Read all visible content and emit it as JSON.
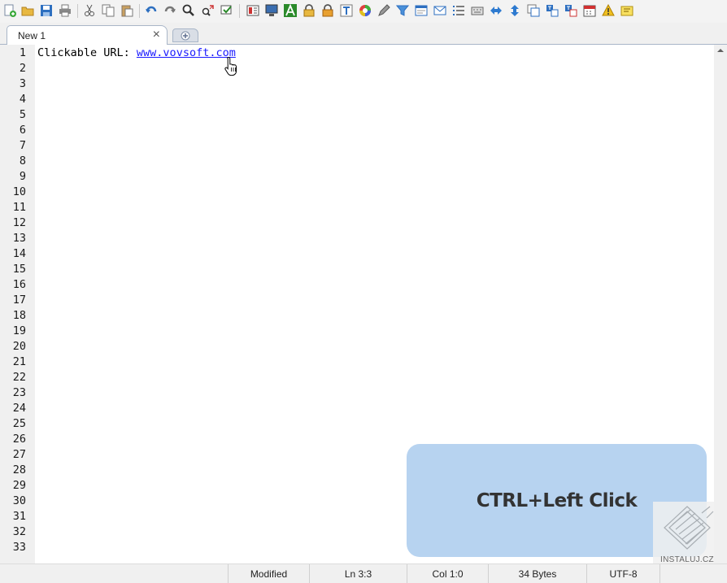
{
  "toolbar": {
    "icons": [
      "new-file-icon",
      "open-folder-icon",
      "save-icon",
      "print-icon",
      "cut-icon",
      "copy-icon",
      "paste-icon",
      "undo-icon",
      "redo-icon",
      "find-icon",
      "replace-icon",
      "goto-icon",
      "bookmark-icon",
      "monitor-icon",
      "font-icon",
      "lock-icon",
      "lock-alt-icon",
      "text-icon",
      "color-picker-icon",
      "pen-icon",
      "filter-icon",
      "browser-icon",
      "mail-icon",
      "list-icon",
      "keyboard-icon",
      "swap-horizontal-icon",
      "swap-vertical-icon",
      "window-icon",
      "translate-icon",
      "translate-alt-icon",
      "calendar-icon",
      "warning-icon",
      "notes-icon"
    ]
  },
  "tabs": [
    {
      "label": "New 1",
      "close": "×"
    }
  ],
  "editor": {
    "line_numbers": [
      "1",
      "2",
      "3",
      "4",
      "5",
      "6",
      "7",
      "8",
      "9",
      "10",
      "11",
      "12",
      "13",
      "14",
      "15",
      "16",
      "17",
      "18",
      "19",
      "20",
      "21",
      "22",
      "23",
      "24",
      "25",
      "26",
      "27",
      "28",
      "29",
      "30",
      "31",
      "32",
      "33"
    ],
    "line1_prefix": "Clickable URL: ",
    "line1_url": "www.vovsoft.com"
  },
  "hint": {
    "text": "CTRL+Left Click"
  },
  "watermark": {
    "text": "INSTALUJ.CZ"
  },
  "statusbar": {
    "state": "Modified",
    "line": "Ln 3:3",
    "column": "Col 1:0",
    "size": "34 Bytes",
    "encoding": "UTF-8"
  },
  "colors": {
    "link": "#1a1aff",
    "hint_bg": "#b7d3f0",
    "accent": "#1e6fd0"
  }
}
